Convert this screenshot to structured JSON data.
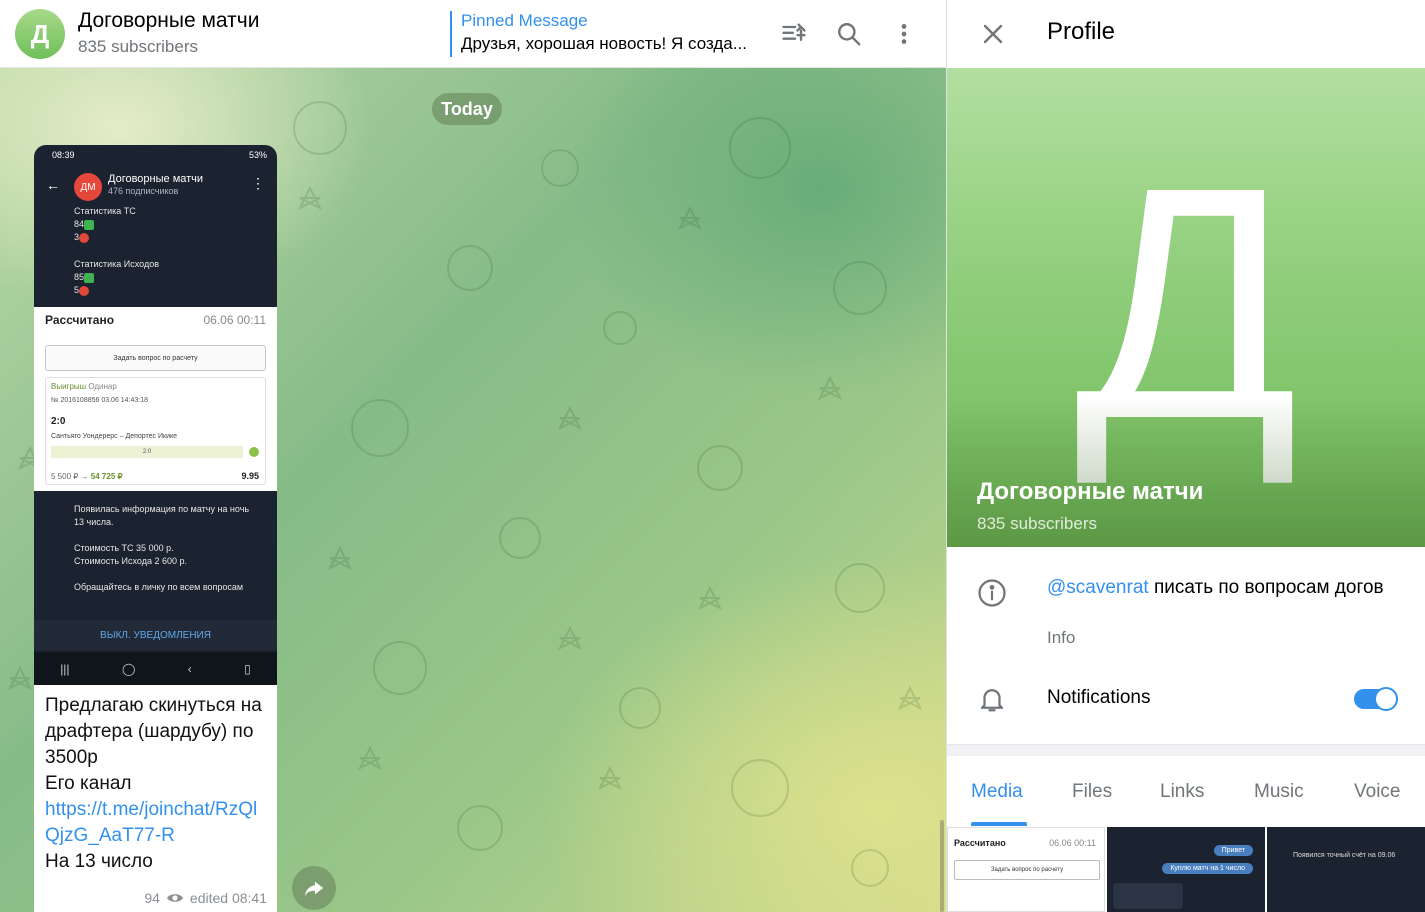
{
  "chat": {
    "avatar_letter": "Д",
    "title": "Договорные матчи",
    "subscribers": "835 subscribers",
    "pinned_title": "Pinned Message",
    "pinned_text": "Друзья, хорошая новость! Я созда...",
    "date_pill": "Today"
  },
  "screenshot": {
    "status_time": "08:39",
    "status_battery": "53%",
    "avatar": "ДМ",
    "title": "Договорные матчи",
    "subtitle": "476 подписчиков",
    "stats_tc_label": "Статистика ТС",
    "stats_tc_ok": "84",
    "stats_tc_no": "3",
    "stats_out_label": "Статистика Исходов",
    "stats_out_ok": "85",
    "stats_out_no": "5",
    "card_status": "Рассчитано",
    "card_date": "06.06 00:11",
    "card_button": "Задать вопрос по расчету",
    "card_win": "Выигрыш",
    "card_type": "Одинар",
    "card_number": "№ 2016108856  03.06  14:43:18",
    "card_score": "2:0",
    "card_teams": "Сантьяго Уондерерс – Депортес Икике",
    "card_bar": "2:0",
    "card_stake": "5 500 ₽ →",
    "card_payout": "54 725 ₽",
    "card_odds": "9.95",
    "info_1": "Появилась информация по матчу на ночь 13 числа.",
    "info_2": "Стоимость ТС 35 000 р.",
    "info_3": "Стоимость Исхода 2 600 р.",
    "info_4": "Обращайтесь в личку по всем вопросам",
    "mute_button": "ВЫКЛ. УВЕДОМЛЕНИЯ"
  },
  "message": {
    "line1": "Предлагаю скинуться на драфтера (шардубу) по 3500р",
    "line2": "Его канал",
    "link": "https://t.me/joinchat/RzQlQjzG_AaT77-R",
    "line3": "На 13 число",
    "views": "94",
    "edited": "edited 08:41"
  },
  "profile": {
    "title": "Profile",
    "letter": "Д",
    "name": "Договорные матчи",
    "subscribers": "835 subscribers",
    "info_mention": "@scavenrat",
    "info_text": " писать по вопросам догов",
    "info_label": "Info",
    "notifications_label": "Notifications",
    "notifications_on": true,
    "tabs": [
      "Media",
      "Files",
      "Links",
      "Music",
      "Voice"
    ],
    "active_tab": "Media",
    "thumb1_status": "Рассчитано",
    "thumb1_date": "06.06 00:11",
    "thumb1_button": "Задать вопрос по расчету",
    "thumb2_msg1": "Привет",
    "thumb2_msg2": "Куплю матч на 1 число",
    "thumb3_text": "Появился точный счёт на 09.06"
  },
  "colors": {
    "accent": "#3390ec",
    "avatar_green": "#7cc466"
  },
  "icons": [
    "pin-list-icon",
    "search-icon",
    "more-vertical-icon",
    "close-icon",
    "info-icon",
    "bell-icon",
    "eye-icon",
    "share-icon"
  ]
}
